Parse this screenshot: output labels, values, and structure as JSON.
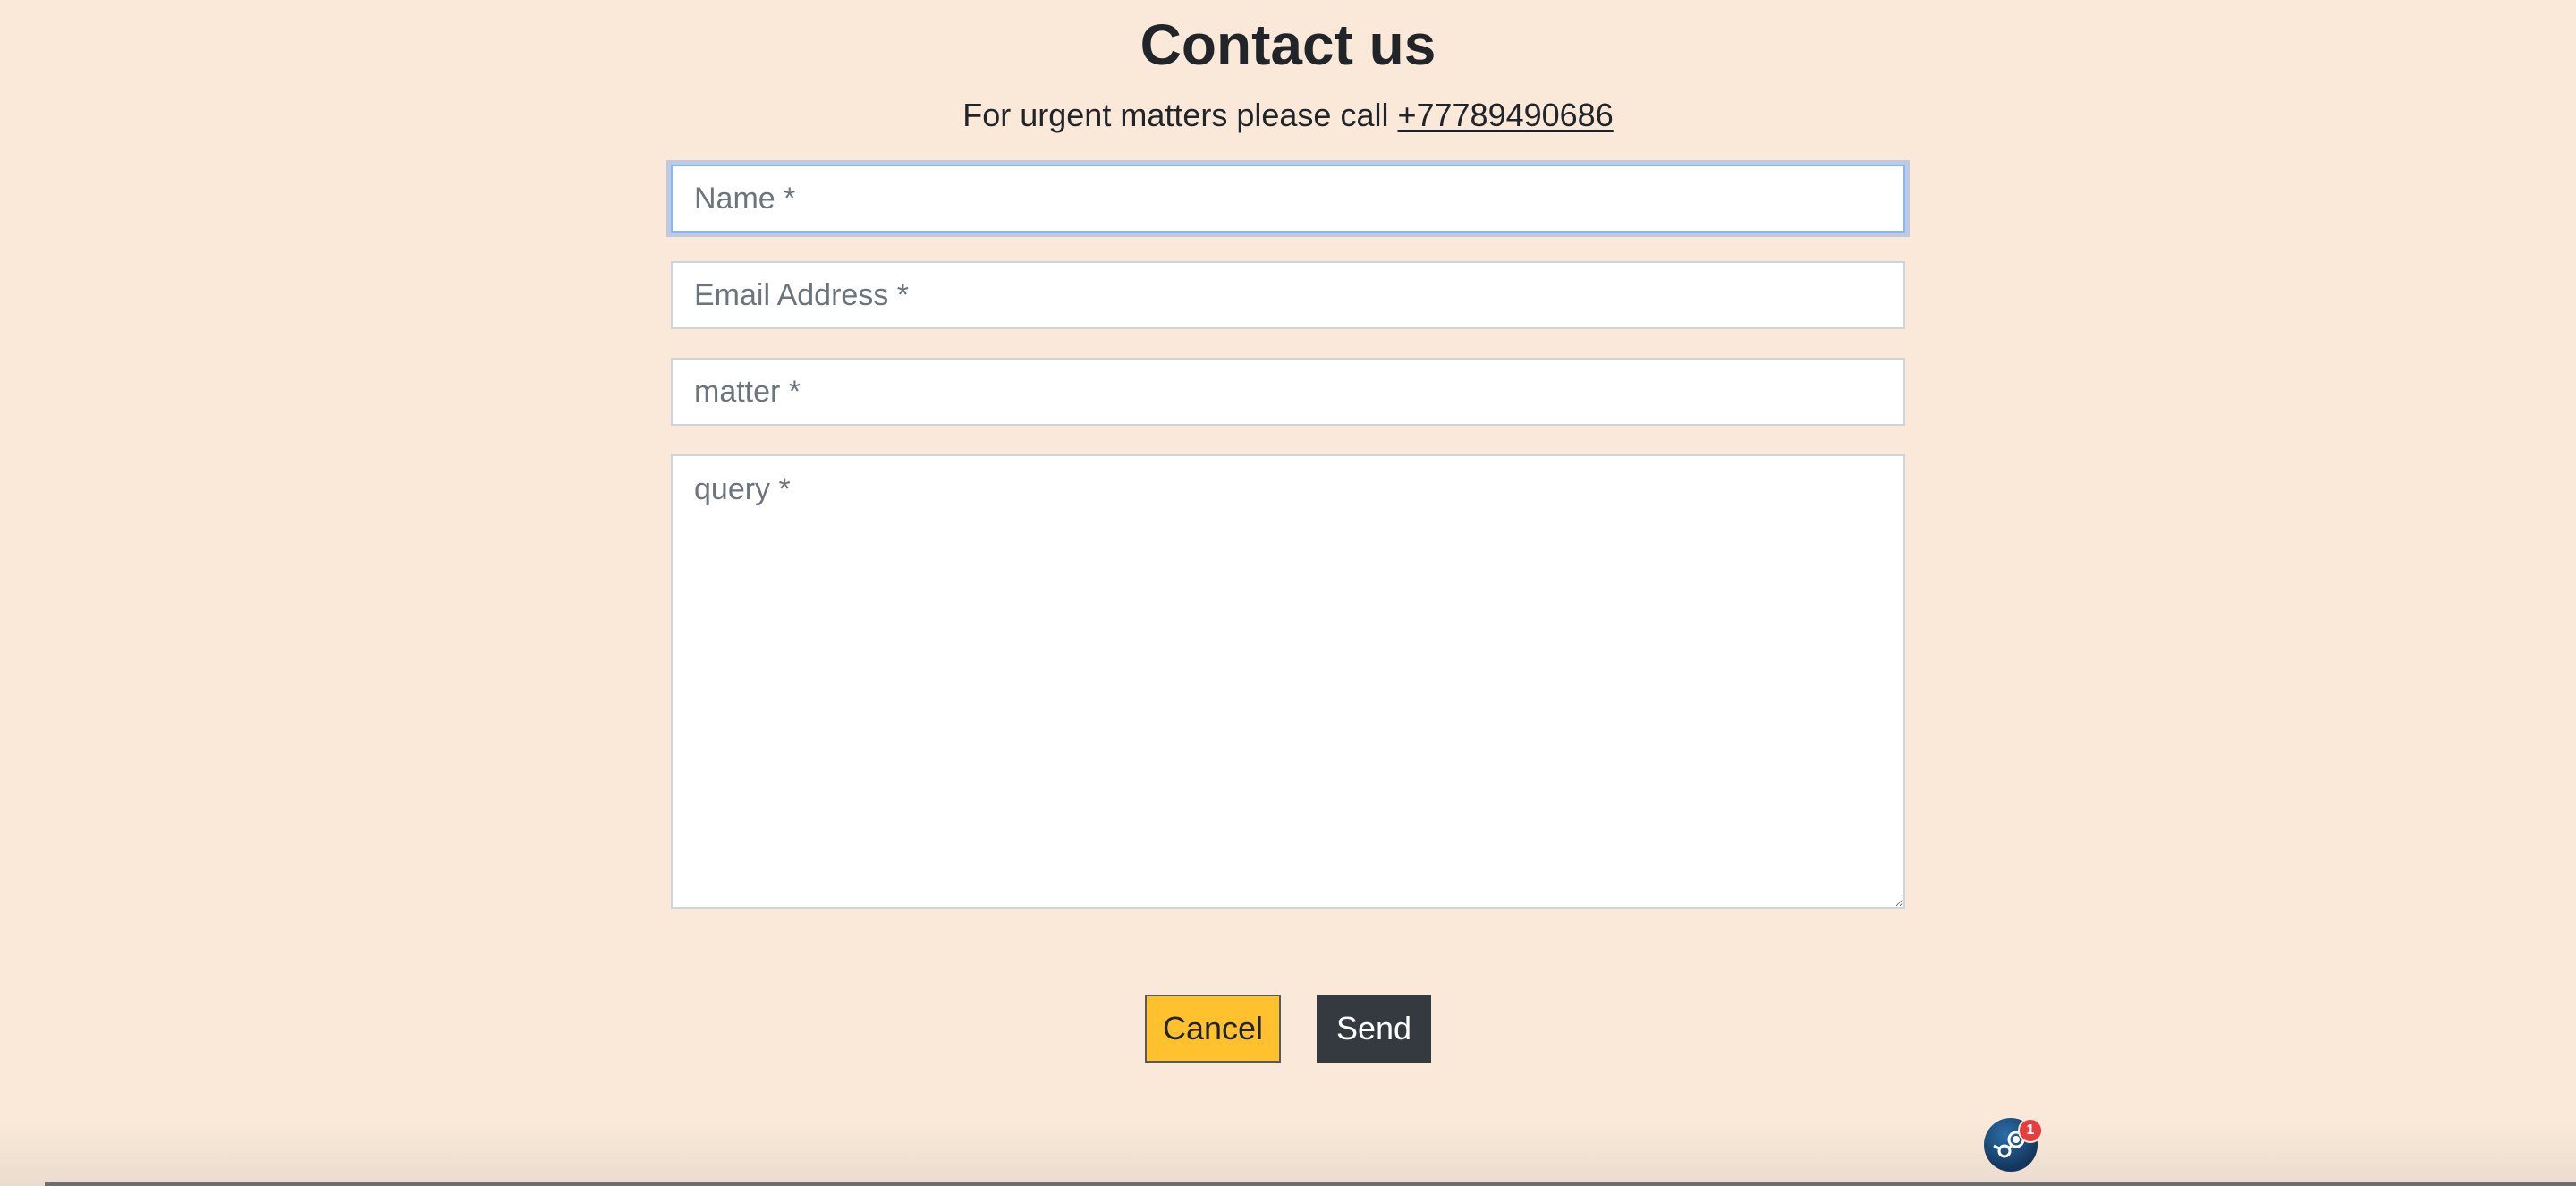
{
  "page": {
    "title": "Contact us",
    "subtitle_text": "For urgent matters please call ",
    "phone_link": "+77789490686"
  },
  "form": {
    "name_placeholder": "Name *",
    "email_placeholder": "Email Address *",
    "matter_placeholder": "matter *",
    "query_placeholder": "query *",
    "cancel_label": "Cancel",
    "send_label": "Send"
  },
  "widget": {
    "icon": "steam-icon",
    "badge_count": "1"
  },
  "colors": {
    "background": "#fae9d8",
    "cancel_button": "#ffc12e",
    "send_button": "#343a40",
    "badge": "#e53e3e"
  }
}
